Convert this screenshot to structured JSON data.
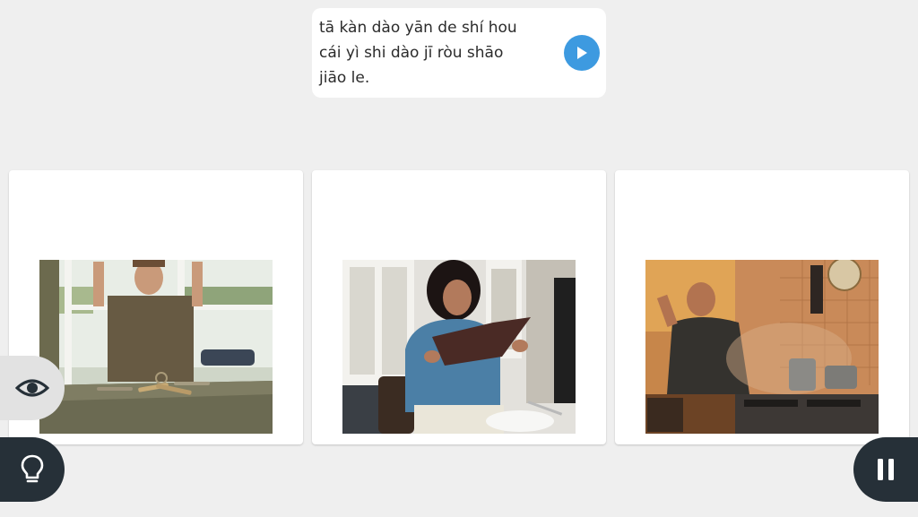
{
  "prompt": {
    "lines": [
      "tā kàn dào yān de shí hou",
      "cái yì shi dào jī ròu shāo",
      "jiāo le."
    ],
    "play_icon": "play-icon"
  },
  "choices": [
    {
      "image": "man-outside-window-keys-photo"
    },
    {
      "image": "woman-reading-menu-photo"
    },
    {
      "image": "man-smoky-kitchen-photo"
    }
  ],
  "controls": {
    "left_top_icon": "eye-icon",
    "left_bottom_icon": "lightbulb-icon",
    "right_bottom_icon": "pause-icon"
  },
  "colors": {
    "background": "#efefef",
    "accent": "#3d9ae0",
    "control_dark": "#263038",
    "control_light": "#e2e2e2"
  }
}
